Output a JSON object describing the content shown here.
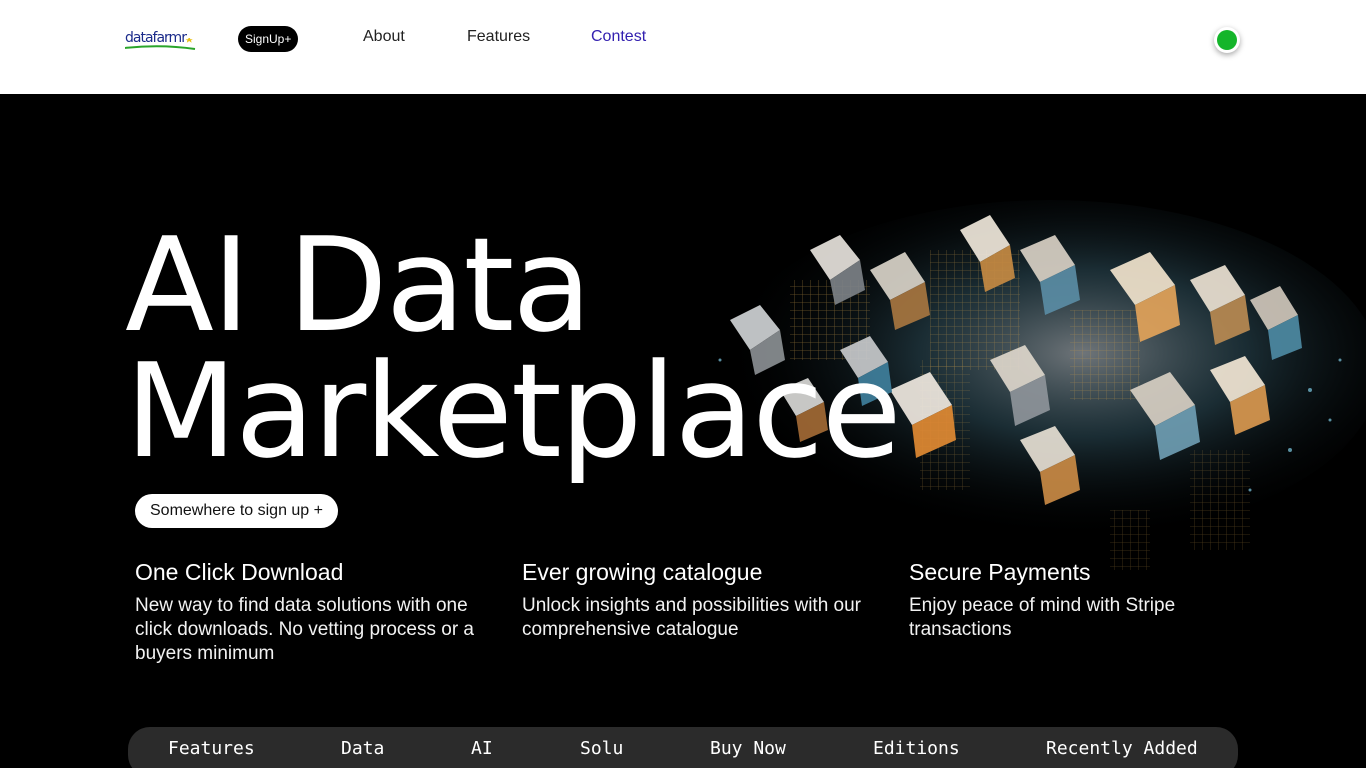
{
  "header": {
    "logo_text": "datafarmr",
    "signup_label": "SignUp+",
    "nav": [
      {
        "label": "About"
      },
      {
        "label": "Features"
      },
      {
        "label": "Contest"
      }
    ],
    "status_color": "#14b52a"
  },
  "hero": {
    "title_line1": "AI Data",
    "title_line2": "Marketplace",
    "cta_label": "Somewhere to sign up +"
  },
  "features": [
    {
      "title": "One Click Download",
      "text": "New way to find data solutions with one click downloads. No vetting process or a buyers minimum"
    },
    {
      "title": "Ever growing catalogue",
      "text": "Unlock insights and possibilities with our comprehensive catalogue"
    },
    {
      "title": "Secure Payments",
      "text": "Enjoy peace of mind with Stripe transactions"
    }
  ],
  "bottom_nav": [
    {
      "label": "Features"
    },
    {
      "label": "Data"
    },
    {
      "label": "AI"
    },
    {
      "label": "Solu"
    },
    {
      "label": "Buy Now"
    },
    {
      "label": "Editions"
    },
    {
      "label": "Recently Added"
    }
  ]
}
